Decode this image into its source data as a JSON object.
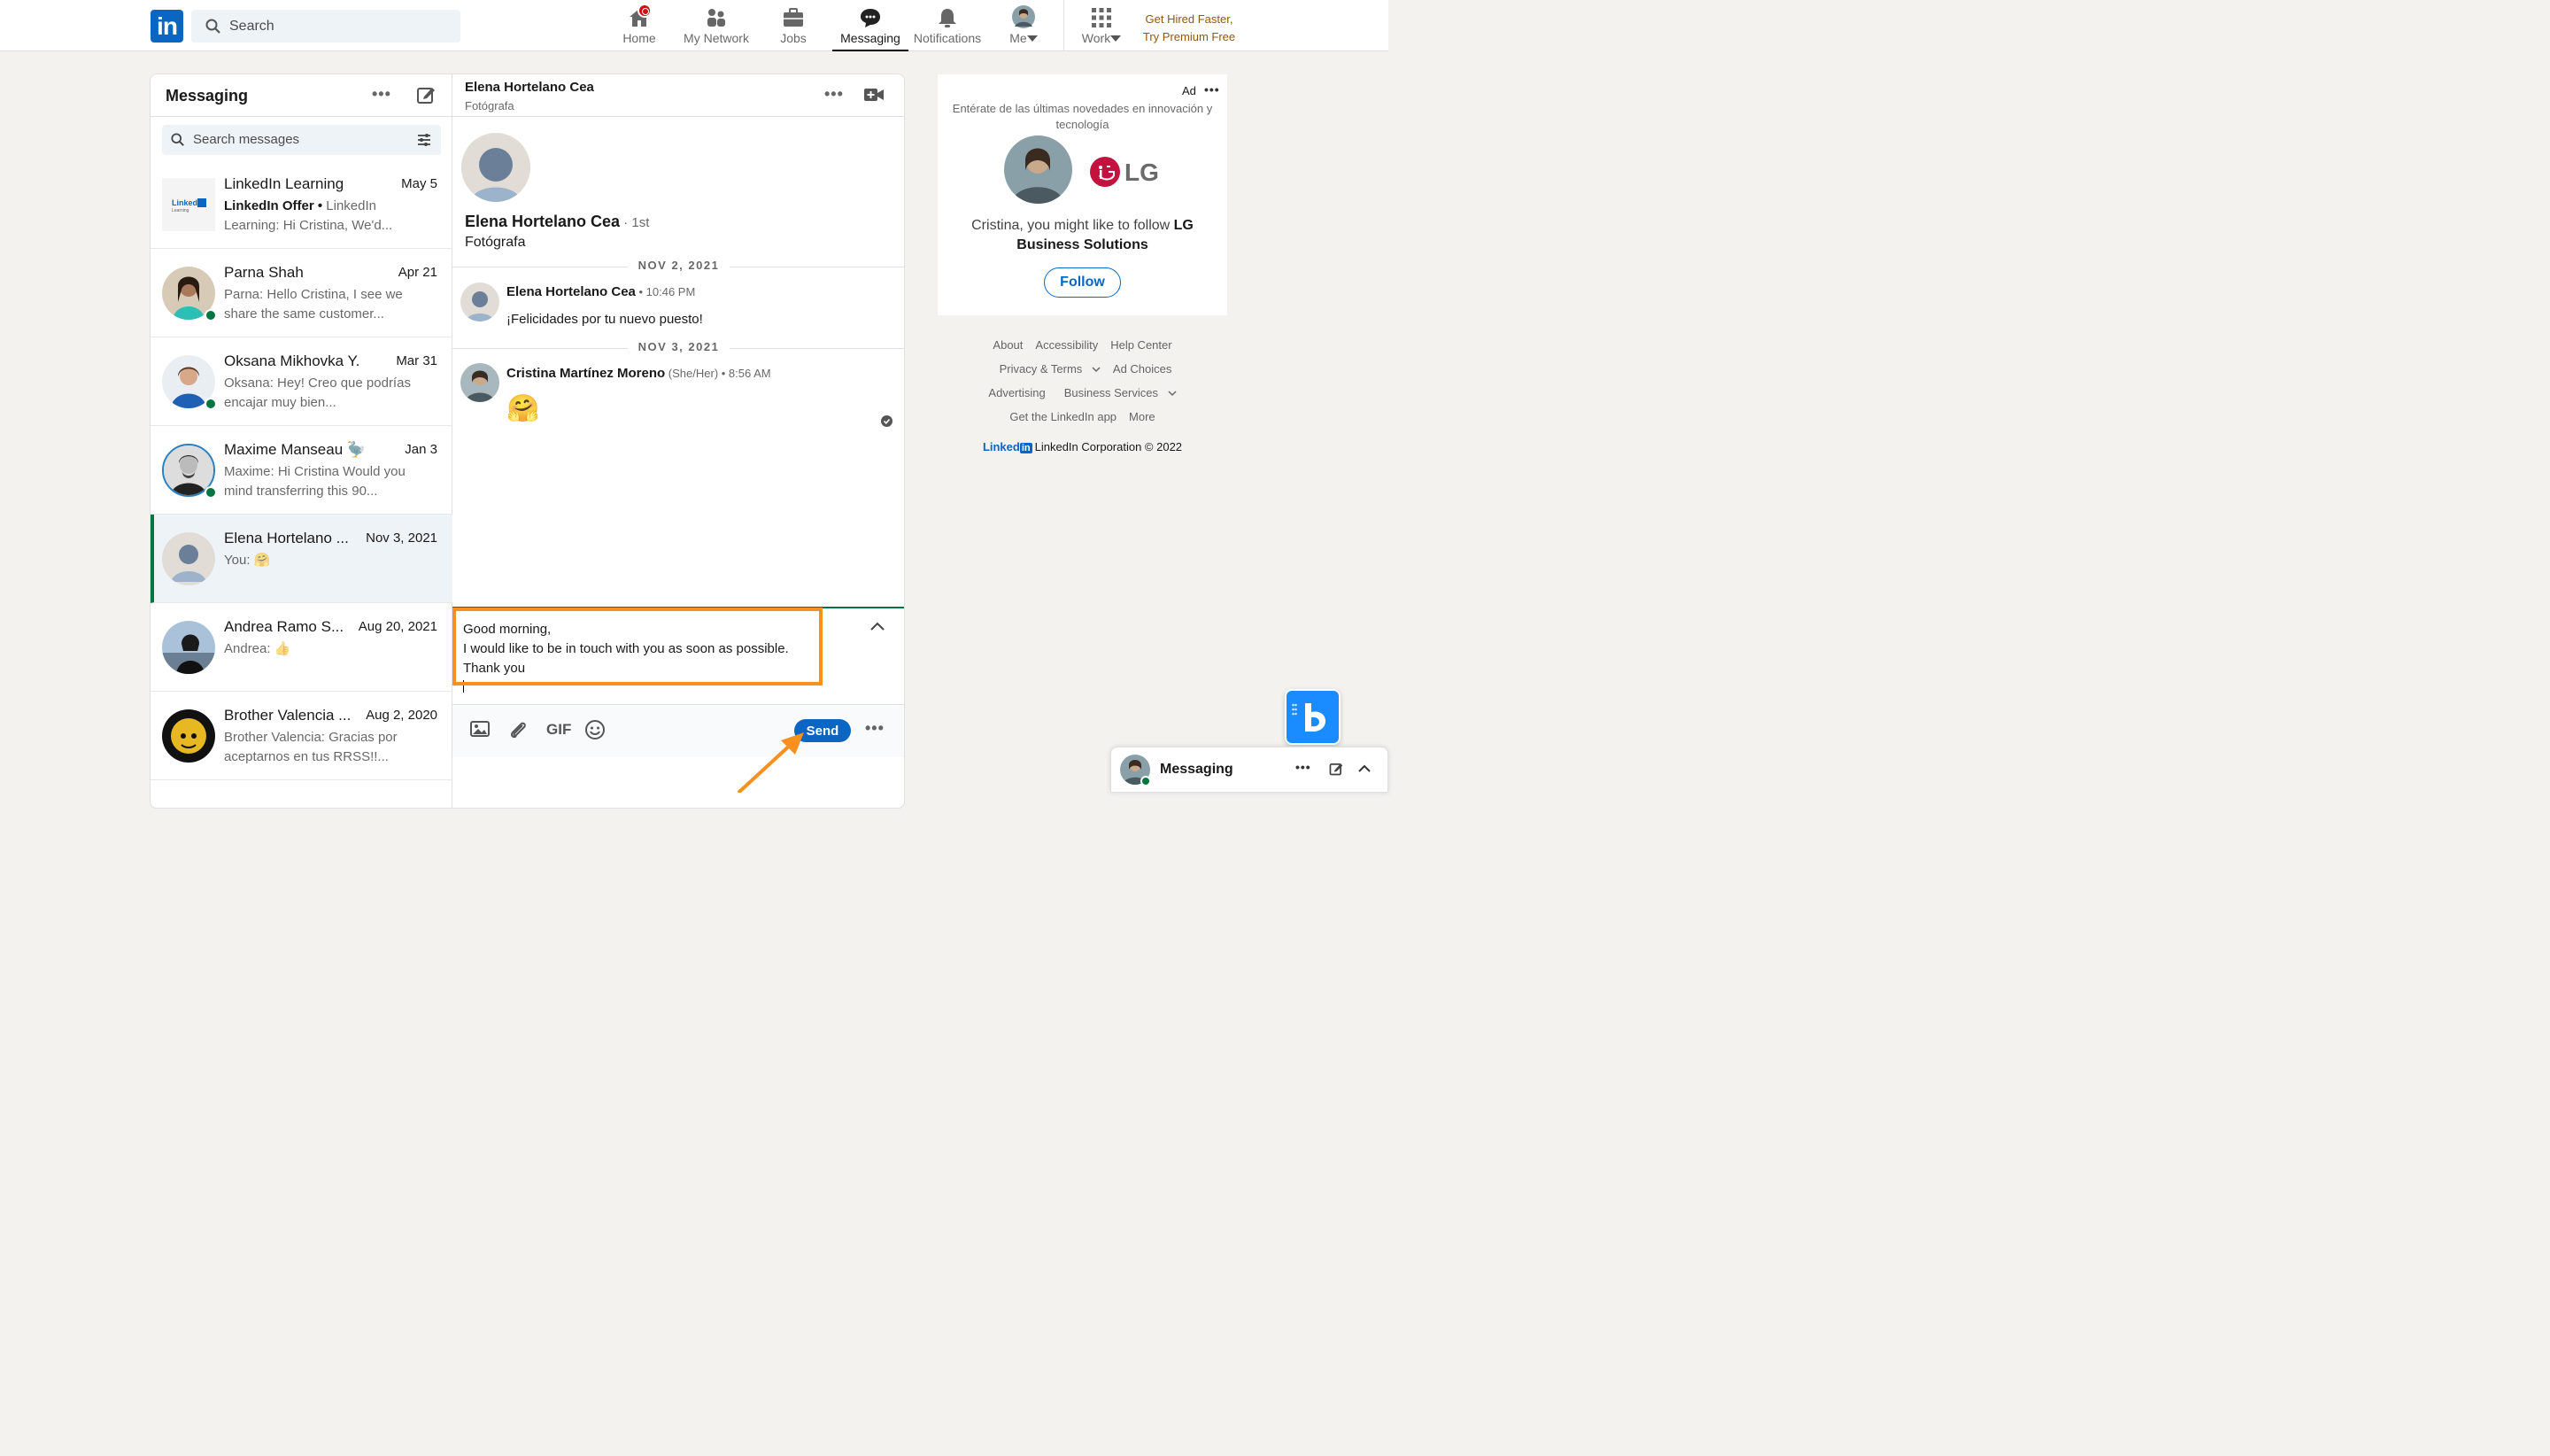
{
  "topbar": {
    "search_placeholder": "Search",
    "nav": [
      {
        "label": "Home"
      },
      {
        "label": "My Network"
      },
      {
        "label": "Jobs"
      },
      {
        "label": "Messaging"
      },
      {
        "label": "Notifications"
      },
      {
        "label": "Me"
      },
      {
        "label": "Work"
      }
    ],
    "premium_line1": "Get Hired Faster,",
    "premium_line2": "Try Premium Free"
  },
  "messaging": {
    "title": "Messaging",
    "search_placeholder": "Search messages",
    "conversations": [
      {
        "name": "LinkedIn Learning",
        "date": "May 5",
        "preview_bold": "LinkedIn Offer • ",
        "preview": "LinkedIn Learning: Hi Cristina, We'd..."
      },
      {
        "name": "Parna Shah",
        "date": "Apr 21",
        "preview": "Parna: Hello Cristina, I see we share the same customer..."
      },
      {
        "name": "Oksana Mikhovka Y.",
        "date": "Mar 31",
        "preview": "Oksana: Hey! Creo que podrías encajar muy bien..."
      },
      {
        "name": "Maxime Manseau 🦤",
        "date": "Jan 3",
        "preview": "Maxime: Hi Cristina Would you mind transferring this 90..."
      },
      {
        "name": "Elena Hortelano ...",
        "date": "Nov 3, 2021",
        "preview": "You: 🤗"
      },
      {
        "name": "Andrea Ramo S...",
        "date": "Aug 20, 2021",
        "preview": "Andrea: 👍"
      },
      {
        "name": "Brother Valencia ...",
        "date": "Aug 2, 2020",
        "preview": "Brother Valencia: Gracias por aceptarnos en tus RRSS!!..."
      }
    ]
  },
  "thread": {
    "header_name": "Elena Hortelano Cea",
    "header_title": "Fotógrafa",
    "profile_name": "Elena Hortelano Cea",
    "profile_degree": " · 1st",
    "profile_title": "Fotógrafa",
    "day1": "NOV 2, 2021",
    "msg1_from": "Elena Hortelano Cea",
    "msg1_time": " • 10:46 PM",
    "msg1_text": "¡Felicidades por tu nuevo puesto!",
    "day2": "NOV 3, 2021",
    "msg2_from": "Cristina Martínez Moreno",
    "msg2_pronouns": " (She/Her)",
    "msg2_time": " • 8:56 AM",
    "msg2_text": "🤗",
    "compose_line1": "Good morning,",
    "compose_line2": "I would like to be in touch with you as soon as possible.",
    "compose_line3": "Thank you",
    "gif_label": "GIF",
    "send_label": "Send"
  },
  "ad": {
    "label": "Ad",
    "tagline": "Entérate de las últimas novedades en innovación y tecnología",
    "brand": "LG",
    "text_prefix": "Cristina, you might like to follow ",
    "text_bold": "LG Business Solutions",
    "follow_label": "Follow"
  },
  "footer": {
    "links": [
      "About",
      "Accessibility",
      "Help Center",
      "Privacy & Terms",
      "Ad Choices",
      "Advertising",
      "Business Services",
      "Get the LinkedIn app",
      "More"
    ],
    "brand_word": "Linked",
    "brand_box": "in",
    "copyright": "LinkedIn Corporation © 2022"
  },
  "dock": {
    "label": "Messaging"
  },
  "colors": {
    "linkedin_blue": "#0a66c2",
    "online_green": "#057642",
    "highlight_orange": "#f7901e",
    "premium_gold": "#915907"
  }
}
